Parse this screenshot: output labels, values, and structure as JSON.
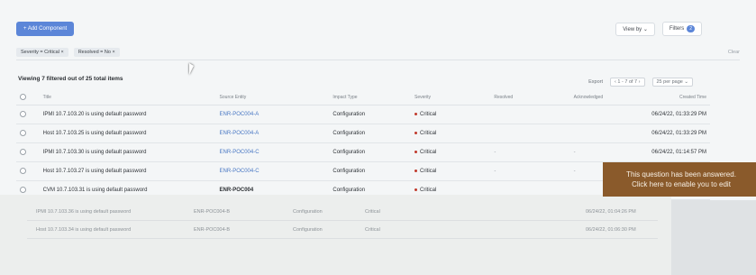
{
  "toolbar": {
    "primary_label": "+ Add Component",
    "view_label": "View by",
    "filters_label": "Filters",
    "filters_count": "2"
  },
  "filters": [
    {
      "label": "Severity = Critical"
    },
    {
      "label": "Resolved = No"
    }
  ],
  "filters_clear": "Clear",
  "table": {
    "summary": "Viewing 7 filtered out of 25 total items",
    "pager_export": "Export",
    "pager_pages": "1 - 7 of 7",
    "pager_per_page": "25 per page",
    "columns": [
      "Title",
      "Source Entity",
      "Impact Type",
      "Severity",
      "Resolved",
      "Acknowledged",
      "Created Time"
    ],
    "rows": [
      {
        "title": "IPMI 10.7.103.20 is using default password",
        "entity": "ENR-POC004-A",
        "impact": "Configuration",
        "severity": "Critical",
        "resolved": "",
        "ack": "",
        "created": "06/24/22, 01:33:29 PM"
      },
      {
        "title": "Host 10.7.103.25 is using default password",
        "entity": "ENR-POC004-A",
        "impact": "Configuration",
        "severity": "Critical",
        "resolved": "",
        "ack": "",
        "created": "06/24/22, 01:33:29 PM"
      },
      {
        "title": "IPMI 10.7.103.30 is using default password",
        "entity": "ENR-POC004-C",
        "impact": "Configuration",
        "severity": "Critical",
        "resolved": "-",
        "ack": "-",
        "created": "06/24/22, 01:14:57 PM"
      },
      {
        "title": "Host 10.7.103.27 is using default password",
        "entity": "ENR-POC004-C",
        "impact": "Configuration",
        "severity": "Critical",
        "resolved": "-",
        "ack": "-",
        "created": ""
      },
      {
        "title": "CVM 10.7.103.31 is using default password",
        "entity": "ENR-POC004",
        "impact": "Configuration",
        "severity": "Critical",
        "resolved": "",
        "ack": "",
        "created": ""
      }
    ]
  },
  "lower_rows": [
    {
      "title": "IPMI 10.7.103.36 is using default password",
      "entity": "ENR-POC004-B",
      "impact": "Configuration",
      "severity": "Critical",
      "created": "06/24/22, 01:04:26 PM"
    },
    {
      "title": "Host 10.7.103.34 is using default password",
      "entity": "ENR-POC004-B",
      "impact": "Configuration",
      "severity": "Critical",
      "created": "06/24/22, 01:06:30 PM"
    }
  ],
  "toast": {
    "line1": "This question has been answered.",
    "line2": "Click here to enable you to edit"
  },
  "colors": {
    "accent": "#5c86d8",
    "link": "#4a78c4",
    "critical": "#c0392b",
    "toast_bg": "#8a5a2b"
  }
}
